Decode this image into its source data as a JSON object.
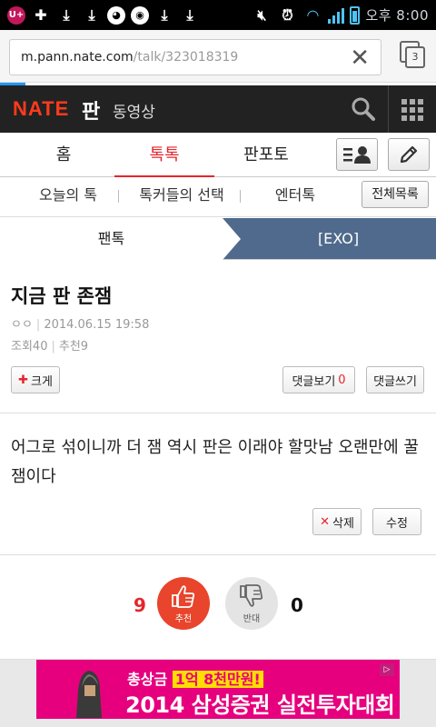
{
  "status_bar": {
    "time": "오후 8:00",
    "carrier_icon": "uplus-icon"
  },
  "url_bar": {
    "host": "m.pann.nate.com",
    "path": "/talk/323018319",
    "tab_count": "3"
  },
  "header": {
    "logo": "NATE",
    "section": "판",
    "video_link": "동영상"
  },
  "main_tabs": [
    {
      "label": "홈"
    },
    {
      "label": "톡톡"
    },
    {
      "label": "판포토"
    }
  ],
  "sub_tabs": [
    {
      "label": "오늘의 톡"
    },
    {
      "label": "톡커들의 선택"
    },
    {
      "label": "엔터톡"
    }
  ],
  "all_list_label": "전체목록",
  "breadcrumb": {
    "left": "팬톡",
    "right": "[EXO]"
  },
  "post": {
    "title": "지금 판 존잼",
    "author": "ㅇㅇ",
    "date": "2014.06.15 19:58",
    "views_label": "조회",
    "views": "40",
    "recommend_label": "추천",
    "recommend": "9",
    "body": "어그로 섞이니까 더 잼 역시 판은 이래야 할맛남 오랜만에 꿀잼이다"
  },
  "buttons": {
    "bigger": "크게",
    "view_comments": "댓글보기",
    "comment_count": "0",
    "write_comment": "댓글쓰기",
    "delete": "삭제",
    "edit": "수정"
  },
  "vote": {
    "up_count": "9",
    "up_label": "추천",
    "down_count": "0",
    "down_label": "반대"
  },
  "ad": {
    "line1_prefix": "총상금",
    "line1_highlight": "1억 8천만원!",
    "line2": "2014 삼성증권 실전투자대회"
  },
  "colors": {
    "accent": "#e5262d",
    "header_bg": "#222222",
    "breadcrumb_bg": "#4f6a8c",
    "ad_bg": "#e6007e"
  }
}
